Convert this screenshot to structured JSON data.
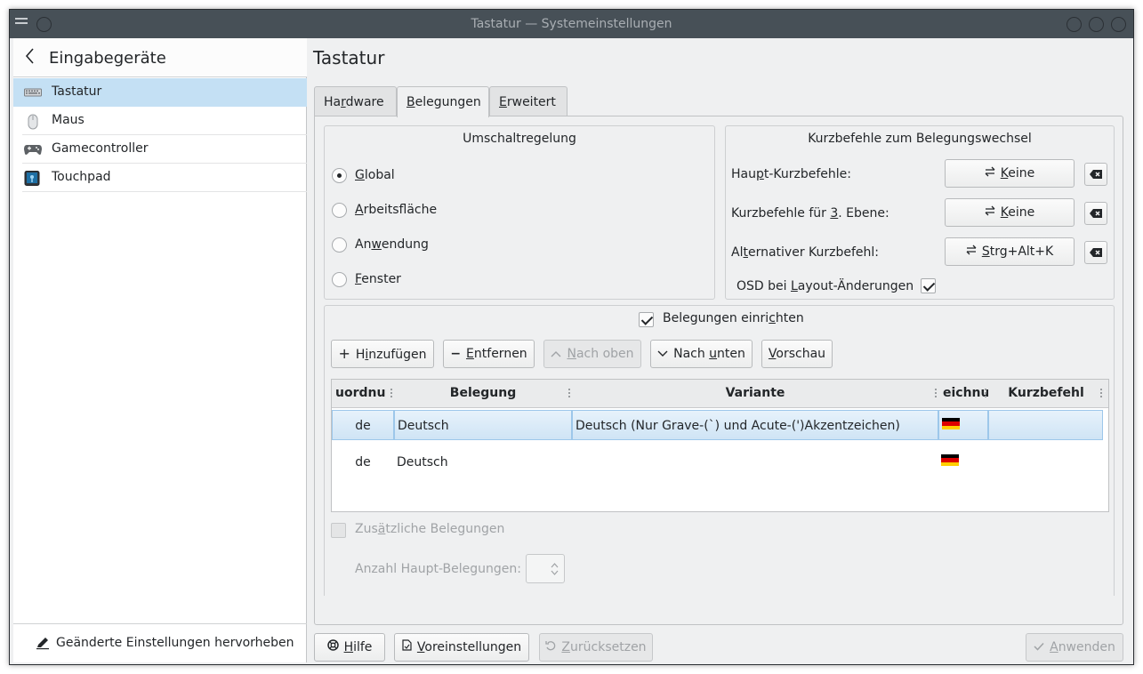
{
  "window": {
    "title": "Tastatur — Systemeinstellungen"
  },
  "sidebar": {
    "header": "Eingabegeräte",
    "items": [
      {
        "label": "Tastatur",
        "icon": "keyboard-icon"
      },
      {
        "label": "Maus",
        "icon": "mouse-icon"
      },
      {
        "label": "Gamecontroller",
        "icon": "gamepad-icon"
      },
      {
        "label": "Touchpad",
        "icon": "touchpad-icon"
      }
    ],
    "footer": "Geänderte Einstellungen hervorheben"
  },
  "main": {
    "title": "Tastatur",
    "tabs": [
      {
        "pre": "Ha",
        "u": "r",
        "post": "dware"
      },
      {
        "pre": "",
        "u": "B",
        "post": "elegungen"
      },
      {
        "pre": "",
        "u": "E",
        "post": "rweitert"
      }
    ],
    "switching": {
      "title": "Umschaltregelung",
      "options": [
        {
          "u": "G",
          "rest": "lobal"
        },
        {
          "u": "A",
          "rest": "rbeitsfläche"
        },
        {
          "pre": "An",
          "u": "w",
          "rest": "endung"
        },
        {
          "u": "F",
          "rest": "enster"
        }
      ]
    },
    "shortcuts": {
      "title": "Kurzbefehle zum Belegungswechsel",
      "rows": [
        {
          "pre": "Hau",
          "u": "p",
          "post": "t-Kurzbefehle:",
          "value_u": "K",
          "value_rest": "eine"
        },
        {
          "pre": "Kurzbefehle für ",
          "u": "3",
          "post": ". Ebene:",
          "value_u": "K",
          "value_rest": "eine"
        },
        {
          "pre": "Al",
          "u": "t",
          "post": "ernativer Kurzbefehl:",
          "value_u": "S",
          "value_rest": "trg+Alt+K"
        }
      ],
      "osd": {
        "pre": "OSD bei ",
        "u": "L",
        "post": "ayout-Änderungen"
      }
    },
    "layouts": {
      "enable": {
        "pre": "Belegungen einri",
        "u": "c",
        "post": "hten"
      },
      "buttons": {
        "add": {
          "pre": "H",
          "u": "i",
          "post": "nzufügen"
        },
        "remove": {
          "pre": "",
          "u": "E",
          "post": "ntfernen"
        },
        "up": {
          "pre": "",
          "u": "N",
          "post": "ach oben"
        },
        "down": {
          "pre": "Nach ",
          "u": "u",
          "post": "nten"
        },
        "preview": {
          "pre": "",
          "u": "V",
          "post": "orschau"
        }
      },
      "columns": [
        "uordnu",
        "Belegung",
        "Variante",
        "eichnu",
        "Kurzbefehl"
      ],
      "rows": [
        {
          "map": "de",
          "layout": "Deutsch",
          "variant": "Deutsch (Nur Grave-(`) und Acute-(')Akzentzeichen)",
          "shortcut": ""
        },
        {
          "map": "de",
          "layout": "Deutsch",
          "variant": "",
          "shortcut": ""
        }
      ],
      "extra": {
        "pre": "Zus",
        "u": "ä",
        "post": "tzliche Belegungen"
      },
      "main_count_label": "Anzahl Haupt-Belegungen:"
    },
    "footer": {
      "help": {
        "u": "H",
        "rest": "ilfe"
      },
      "defaults": {
        "u": "V",
        "rest": "oreinstellungen"
      },
      "reset": {
        "u": "Z",
        "rest": "urücksetzen"
      },
      "apply": {
        "u": "A",
        "rest": "nwenden"
      }
    }
  },
  "colors": {
    "accent": "#3daee9",
    "selection": "#c4e0f4",
    "titlebar": "#475057"
  }
}
